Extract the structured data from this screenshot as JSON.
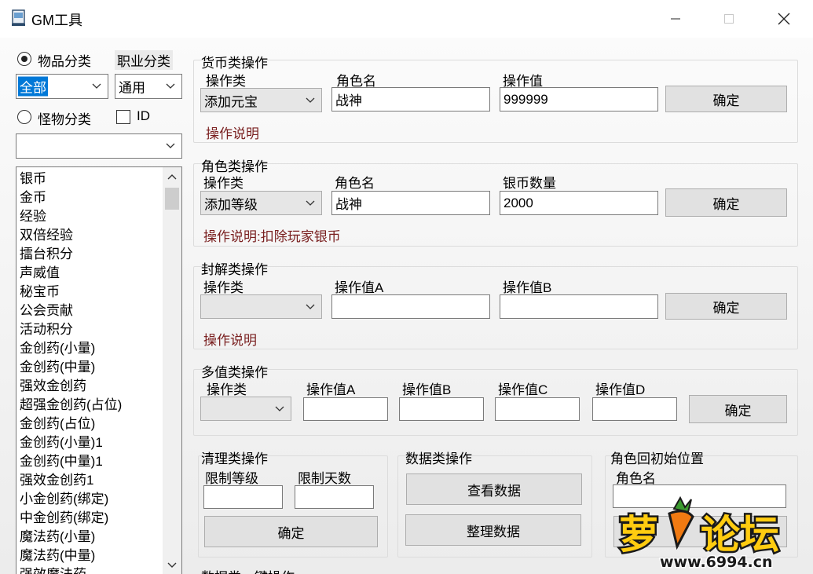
{
  "window": {
    "title": "GM工具"
  },
  "left": {
    "radio_items": "物品分类",
    "job_category": "职业分类",
    "item_combo": "全部",
    "job_combo": "通用",
    "radio_monster": "怪物分类",
    "id_checkbox": "ID",
    "monster_combo": "",
    "items": [
      "银币",
      "金币",
      "经验",
      "双倍经验",
      "擂台积分",
      "声威值",
      "秘宝币",
      "公会贡献",
      "活动积分",
      "金创药(小量)",
      "金创药(中量)",
      "强效金创药",
      "超强金创药(占位)",
      "金创药(占位)",
      "金创药(小量)1",
      "金创药(中量)1",
      "强效金创药1",
      "小金创药(绑定)",
      "中金创药(绑定)",
      "魔法药(小量)",
      "魔法药(中量)",
      "强效魔法药"
    ]
  },
  "currency": {
    "title": "货币类操作",
    "op_type_label": "操作类",
    "role_label": "角色名",
    "value_label": "操作值",
    "op_type": "添加元宝",
    "role": "战神",
    "value": "999999",
    "confirm": "确定",
    "desc": "操作说明"
  },
  "role_ops": {
    "title": "角色类操作",
    "op_type_label": "操作类",
    "role_label": "角色名",
    "value_label": "银币数量",
    "op_type": "添加等级",
    "role": "战神",
    "value": "2000",
    "confirm": "确定",
    "desc": "操作说明:扣除玩家银币"
  },
  "ban_ops": {
    "title": "封解类操作",
    "op_type_label": "操作类",
    "value_a_label": "操作值A",
    "value_b_label": "操作值B",
    "confirm": "确定",
    "desc": "操作说明"
  },
  "multi_ops": {
    "title": "多值类操作",
    "op_type_label": "操作类",
    "a_label": "操作值A",
    "b_label": "操作值B",
    "c_label": "操作值C",
    "d_label": "操作值D",
    "confirm": "确定"
  },
  "clean_ops": {
    "title": "清理类操作",
    "level_label": "限制等级",
    "days_label": "限制天数",
    "confirm": "确定"
  },
  "data_ops": {
    "title": "数据类操作",
    "view": "查看数据",
    "organize": "整理数据"
  },
  "reset_pos": {
    "title": "角色回初始位置",
    "role_label": "角色名"
  },
  "bottom_partial": "数据类一键操作",
  "watermark": {
    "main": "萝卜论坛",
    "url": "www.6994.cn"
  }
}
